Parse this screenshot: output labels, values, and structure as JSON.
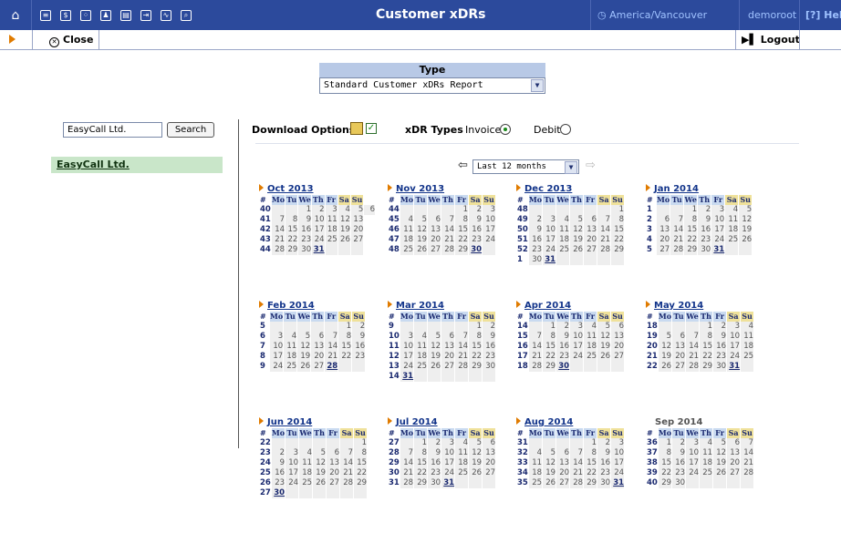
{
  "topbar": {
    "title": "Customer xDRs",
    "timezone": "America/Vancouver",
    "user": "demoroot",
    "help_label": "Help",
    "icons": [
      "home-icon",
      "list-icon",
      "dollar-icon",
      "grid-icon",
      "user-icon",
      "id-card-icon",
      "transfer-icon",
      "chart-icon",
      "search-icon"
    ]
  },
  "actions": {
    "close_label": "Close",
    "logout_label": "Logout"
  },
  "type_selector": {
    "header": "Type",
    "selected": "Standard Customer xDRs Report"
  },
  "search": {
    "value": "EasyCall Ltd.",
    "button_label": "Search",
    "result": "EasyCall Ltd."
  },
  "options": {
    "download_label": "Download Options",
    "xdr_types_label": "xDR Types",
    "invoice_label": "Invoice",
    "debit_label": "Debit",
    "invoice_selected": true,
    "debit_selected": false
  },
  "period": {
    "selected": "Last 12 months"
  },
  "weekday_header": [
    "#",
    "Mo",
    "Tu",
    "We",
    "Th",
    "Fr",
    "Sa",
    "Su"
  ],
  "months": [
    {
      "title": "Oct 2013",
      "link": true,
      "rows": [
        [
          40,
          "",
          "",
          1,
          2,
          3,
          4,
          5,
          6
        ],
        [
          41,
          7,
          8,
          9,
          10,
          11,
          12,
          13
        ],
        [
          42,
          14,
          15,
          16,
          17,
          18,
          19,
          20
        ],
        [
          43,
          21,
          22,
          23,
          24,
          25,
          26,
          27
        ],
        [
          44,
          28,
          29,
          30,
          "31*",
          "",
          "",
          ""
        ]
      ]
    },
    {
      "title": "Nov 2013",
      "link": true,
      "rows": [
        [
          44,
          "",
          "",
          "",
          "",
          1,
          2,
          3
        ],
        [
          45,
          4,
          5,
          6,
          7,
          8,
          9,
          10
        ],
        [
          46,
          11,
          12,
          13,
          14,
          15,
          16,
          17
        ],
        [
          47,
          18,
          19,
          20,
          21,
          22,
          23,
          24
        ],
        [
          48,
          25,
          26,
          27,
          28,
          29,
          "30*",
          ""
        ]
      ]
    },
    {
      "title": "Dec 2013",
      "link": true,
      "rows": [
        [
          48,
          "",
          "",
          "",
          "",
          "",
          "",
          1
        ],
        [
          49,
          2,
          3,
          4,
          5,
          6,
          7,
          8
        ],
        [
          50,
          9,
          10,
          11,
          12,
          13,
          14,
          15
        ],
        [
          51,
          16,
          17,
          18,
          19,
          20,
          21,
          22
        ],
        [
          52,
          23,
          24,
          25,
          26,
          27,
          28,
          29
        ],
        [
          1,
          30,
          "31*",
          "",
          "",
          "",
          "",
          ""
        ]
      ]
    },
    {
      "title": "Jan 2014",
      "link": true,
      "rows": [
        [
          1,
          "",
          "",
          1,
          2,
          3,
          4,
          5
        ],
        [
          2,
          6,
          7,
          8,
          9,
          10,
          11,
          12
        ],
        [
          3,
          13,
          14,
          15,
          16,
          17,
          18,
          19
        ],
        [
          4,
          20,
          21,
          22,
          23,
          24,
          25,
          26
        ],
        [
          5,
          27,
          28,
          29,
          30,
          "31*",
          "",
          ""
        ]
      ]
    },
    {
      "title": "Feb 2014",
      "link": true,
      "rows": [
        [
          5,
          "",
          "",
          "",
          "",
          "",
          1,
          2
        ],
        [
          6,
          3,
          4,
          5,
          6,
          7,
          8,
          9
        ],
        [
          7,
          10,
          11,
          12,
          13,
          14,
          15,
          16
        ],
        [
          8,
          17,
          18,
          19,
          20,
          21,
          22,
          23
        ],
        [
          9,
          24,
          25,
          26,
          27,
          "28*",
          "",
          ""
        ]
      ]
    },
    {
      "title": "Mar 2014",
      "link": true,
      "rows": [
        [
          9,
          "",
          "",
          "",
          "",
          "",
          1,
          2
        ],
        [
          10,
          3,
          4,
          5,
          6,
          7,
          8,
          9
        ],
        [
          11,
          10,
          11,
          12,
          13,
          14,
          15,
          16
        ],
        [
          12,
          17,
          18,
          19,
          20,
          21,
          22,
          23
        ],
        [
          13,
          24,
          25,
          26,
          27,
          28,
          29,
          30
        ],
        [
          14,
          "31*",
          "",
          "",
          "",
          "",
          "",
          ""
        ]
      ]
    },
    {
      "title": "Apr 2014",
      "link": true,
      "rows": [
        [
          14,
          "",
          1,
          2,
          3,
          4,
          5,
          6
        ],
        [
          15,
          7,
          8,
          9,
          10,
          11,
          12,
          13
        ],
        [
          16,
          14,
          15,
          16,
          17,
          18,
          19,
          20
        ],
        [
          17,
          21,
          22,
          23,
          24,
          25,
          26,
          27
        ],
        [
          18,
          28,
          29,
          "30*",
          "",
          "",
          "",
          ""
        ]
      ]
    },
    {
      "title": "May 2014",
      "link": true,
      "rows": [
        [
          18,
          "",
          "",
          "",
          1,
          2,
          3,
          4
        ],
        [
          19,
          5,
          6,
          7,
          8,
          9,
          10,
          11
        ],
        [
          20,
          12,
          13,
          14,
          15,
          16,
          17,
          18
        ],
        [
          21,
          19,
          20,
          21,
          22,
          23,
          24,
          25
        ],
        [
          22,
          26,
          27,
          28,
          29,
          30,
          "31*",
          ""
        ]
      ]
    },
    {
      "title": "Jun 2014",
      "link": true,
      "rows": [
        [
          22,
          "",
          "",
          "",
          "",
          "",
          "",
          1
        ],
        [
          23,
          2,
          3,
          4,
          5,
          6,
          7,
          8
        ],
        [
          24,
          9,
          10,
          11,
          12,
          13,
          14,
          15
        ],
        [
          25,
          16,
          17,
          18,
          19,
          20,
          21,
          22
        ],
        [
          26,
          23,
          24,
          25,
          26,
          27,
          28,
          29
        ],
        [
          27,
          "30*",
          "",
          "",
          "",
          "",
          "",
          ""
        ]
      ]
    },
    {
      "title": "Jul 2014",
      "link": true,
      "rows": [
        [
          27,
          "",
          1,
          2,
          3,
          4,
          5,
          6
        ],
        [
          28,
          7,
          8,
          9,
          10,
          11,
          12,
          13
        ],
        [
          29,
          14,
          15,
          16,
          17,
          18,
          19,
          20
        ],
        [
          30,
          21,
          22,
          23,
          24,
          25,
          26,
          27
        ],
        [
          31,
          28,
          29,
          30,
          "31*",
          "",
          "",
          ""
        ]
      ]
    },
    {
      "title": "Aug 2014",
      "link": true,
      "rows": [
        [
          31,
          "",
          "",
          "",
          "",
          1,
          2,
          3
        ],
        [
          32,
          4,
          5,
          6,
          7,
          8,
          9,
          10
        ],
        [
          33,
          11,
          12,
          13,
          14,
          15,
          16,
          17
        ],
        [
          34,
          18,
          19,
          20,
          21,
          22,
          23,
          24
        ],
        [
          35,
          25,
          26,
          27,
          28,
          29,
          30,
          "31*"
        ]
      ]
    },
    {
      "title": "Sep 2014",
      "link": false,
      "rows": [
        [
          36,
          1,
          2,
          3,
          4,
          5,
          6,
          7
        ],
        [
          37,
          8,
          9,
          10,
          11,
          12,
          13,
          14
        ],
        [
          38,
          15,
          16,
          17,
          18,
          19,
          20,
          21
        ],
        [
          39,
          22,
          23,
          24,
          25,
          26,
          27,
          28
        ],
        [
          40,
          29,
          30,
          "",
          "",
          "",
          "",
          ""
        ]
      ]
    }
  ]
}
